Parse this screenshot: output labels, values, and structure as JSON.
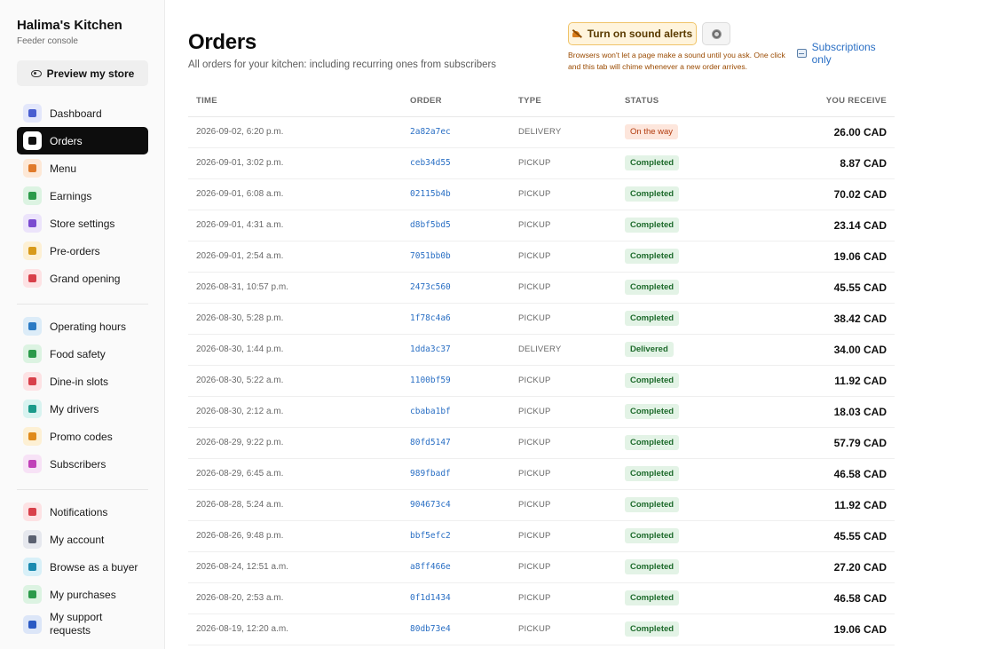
{
  "brand": {
    "title": "Halima's Kitchen",
    "subtitle": "Feeder console"
  },
  "preview_label": "Preview my store",
  "nav_primary": [
    {
      "label": "Dashboard",
      "icon": "bar-chart-icon",
      "color": "#e3e7fb",
      "fg": "#4a5fd0",
      "active": false
    },
    {
      "label": "Orders",
      "icon": "receipt-icon",
      "color": "#ffffff",
      "fg": "#111111",
      "active": true
    },
    {
      "label": "Menu",
      "icon": "burger-icon",
      "color": "#fde8d6",
      "fg": "#e07a2a",
      "active": false
    },
    {
      "label": "Earnings",
      "icon": "cash-icon",
      "color": "#dcf3e2",
      "fg": "#2b9a4a",
      "active": false
    },
    {
      "label": "Store settings",
      "icon": "store-icon",
      "color": "#ece4fb",
      "fg": "#7a4ad0",
      "active": false
    },
    {
      "label": "Pre-orders",
      "icon": "box-icon",
      "color": "#fdf0d4",
      "fg": "#d89a1a",
      "active": false
    },
    {
      "label": "Grand opening",
      "icon": "gift-icon",
      "color": "#fde2e4",
      "fg": "#d8404a",
      "active": false
    }
  ],
  "nav_secondary": [
    {
      "label": "Operating hours",
      "icon": "clock-icon",
      "color": "#dcecf8",
      "fg": "#2a7ac4"
    },
    {
      "label": "Food safety",
      "icon": "shield-icon",
      "color": "#dcf3e2",
      "fg": "#2b9a4a"
    },
    {
      "label": "Dine-in slots",
      "icon": "utensils-icon",
      "color": "#fde2e4",
      "fg": "#d8404a"
    },
    {
      "label": "My drivers",
      "icon": "people-icon",
      "color": "#d8f3f0",
      "fg": "#1a9a8a"
    },
    {
      "label": "Promo codes",
      "icon": "tag-icon",
      "color": "#fdf0d4",
      "fg": "#e08a1a"
    },
    {
      "label": "Subscribers",
      "icon": "repeat-icon",
      "color": "#f7e2f6",
      "fg": "#c040b8"
    }
  ],
  "nav_tertiary": [
    {
      "label": "Notifications",
      "icon": "bell-icon",
      "color": "#fde2e4",
      "fg": "#d8404a"
    },
    {
      "label": "My account",
      "icon": "user-icon",
      "color": "#e6e8ee",
      "fg": "#5a6070"
    },
    {
      "label": "Browse as a buyer",
      "icon": "bag-icon",
      "color": "#d8f0f8",
      "fg": "#1a8ab0"
    },
    {
      "label": "My purchases",
      "icon": "package-icon",
      "color": "#dcf3e2",
      "fg": "#2b9a4a"
    },
    {
      "label": "My support requests",
      "icon": "chat-icon",
      "color": "#dce6f8",
      "fg": "#2a5ac4"
    }
  ],
  "header": {
    "title": "Orders",
    "subtitle": "All orders for your kitchen: including recurring ones from subscribers",
    "sound_button": "Turn on sound alerts",
    "sound_note": "Browsers won't let a page make a sound until you ask. One click and this tab will chime whenever a new order arrives.",
    "subs_filter": "Subscriptions only"
  },
  "table": {
    "columns": [
      "TIME",
      "ORDER",
      "TYPE",
      "STATUS",
      "YOU RECEIVE"
    ],
    "rows": [
      {
        "time": "2026-09-02, 6:20 p.m.",
        "order": "2a82a7ec",
        "type": "DELIVERY",
        "status": "On the way",
        "status_kind": "ontheway",
        "amount": "26.00 CAD"
      },
      {
        "time": "2026-09-01, 3:02 p.m.",
        "order": "ceb34d55",
        "type": "PICKUP",
        "status": "Completed",
        "status_kind": "completed",
        "amount": "8.87 CAD"
      },
      {
        "time": "2026-09-01, 6:08 a.m.",
        "order": "02115b4b",
        "type": "PICKUP",
        "status": "Completed",
        "status_kind": "completed",
        "amount": "70.02 CAD"
      },
      {
        "time": "2026-09-01, 4:31 a.m.",
        "order": "d8bf5bd5",
        "type": "PICKUP",
        "status": "Completed",
        "status_kind": "completed",
        "amount": "23.14 CAD"
      },
      {
        "time": "2026-09-01, 2:54 a.m.",
        "order": "7051bb0b",
        "type": "PICKUP",
        "status": "Completed",
        "status_kind": "completed",
        "amount": "19.06 CAD"
      },
      {
        "time": "2026-08-31, 10:57 p.m.",
        "order": "2473c560",
        "type": "PICKUP",
        "status": "Completed",
        "status_kind": "completed",
        "amount": "45.55 CAD"
      },
      {
        "time": "2026-08-30, 5:28 p.m.",
        "order": "1f78c4a6",
        "type": "PICKUP",
        "status": "Completed",
        "status_kind": "completed",
        "amount": "38.42 CAD"
      },
      {
        "time": "2026-08-30, 1:44 p.m.",
        "order": "1dda3c37",
        "type": "DELIVERY",
        "status": "Delivered",
        "status_kind": "delivered",
        "amount": "34.00 CAD"
      },
      {
        "time": "2026-08-30, 5:22 a.m.",
        "order": "1100bf59",
        "type": "PICKUP",
        "status": "Completed",
        "status_kind": "completed",
        "amount": "11.92 CAD"
      },
      {
        "time": "2026-08-30, 2:12 a.m.",
        "order": "cbaba1bf",
        "type": "PICKUP",
        "status": "Completed",
        "status_kind": "completed",
        "amount": "18.03 CAD"
      },
      {
        "time": "2026-08-29, 9:22 p.m.",
        "order": "80fd5147",
        "type": "PICKUP",
        "status": "Completed",
        "status_kind": "completed",
        "amount": "57.79 CAD"
      },
      {
        "time": "2026-08-29, 6:45 a.m.",
        "order": "989fbadf",
        "type": "PICKUP",
        "status": "Completed",
        "status_kind": "completed",
        "amount": "46.58 CAD"
      },
      {
        "time": "2026-08-28, 5:24 a.m.",
        "order": "904673c4",
        "type": "PICKUP",
        "status": "Completed",
        "status_kind": "completed",
        "amount": "11.92 CAD"
      },
      {
        "time": "2026-08-26, 9:48 p.m.",
        "order": "bbf5efc2",
        "type": "PICKUP",
        "status": "Completed",
        "status_kind": "completed",
        "amount": "45.55 CAD"
      },
      {
        "time": "2026-08-24, 12:51 a.m.",
        "order": "a8ff466e",
        "type": "PICKUP",
        "status": "Completed",
        "status_kind": "completed",
        "amount": "27.20 CAD"
      },
      {
        "time": "2026-08-20, 2:53 a.m.",
        "order": "0f1d1434",
        "type": "PICKUP",
        "status": "Completed",
        "status_kind": "completed",
        "amount": "46.58 CAD"
      },
      {
        "time": "2026-08-19, 12:20 a.m.",
        "order": "80db73e4",
        "type": "PICKUP",
        "status": "Completed",
        "status_kind": "completed",
        "amount": "19.06 CAD"
      }
    ]
  }
}
